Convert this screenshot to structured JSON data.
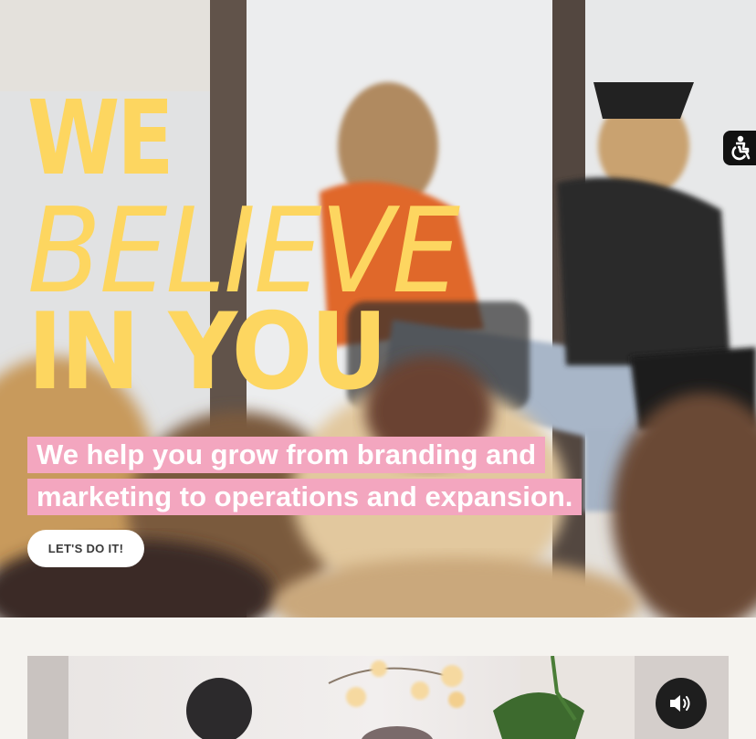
{
  "hero": {
    "headline": {
      "line1": "WE",
      "line2": "BELIEVE",
      "line3": "IN YOU"
    },
    "tagline": {
      "line1": "We help you grow from branding and",
      "line2": "marketing to operations and expansion."
    },
    "cta_label": "LET'S DO IT!"
  },
  "colors": {
    "headline": "#fdd660",
    "tagline_highlight": "#f3a6bf",
    "page_background": "#f5f3ef"
  },
  "icons": {
    "accessibility": "accessibility-icon",
    "sound": "speaker-icon"
  }
}
